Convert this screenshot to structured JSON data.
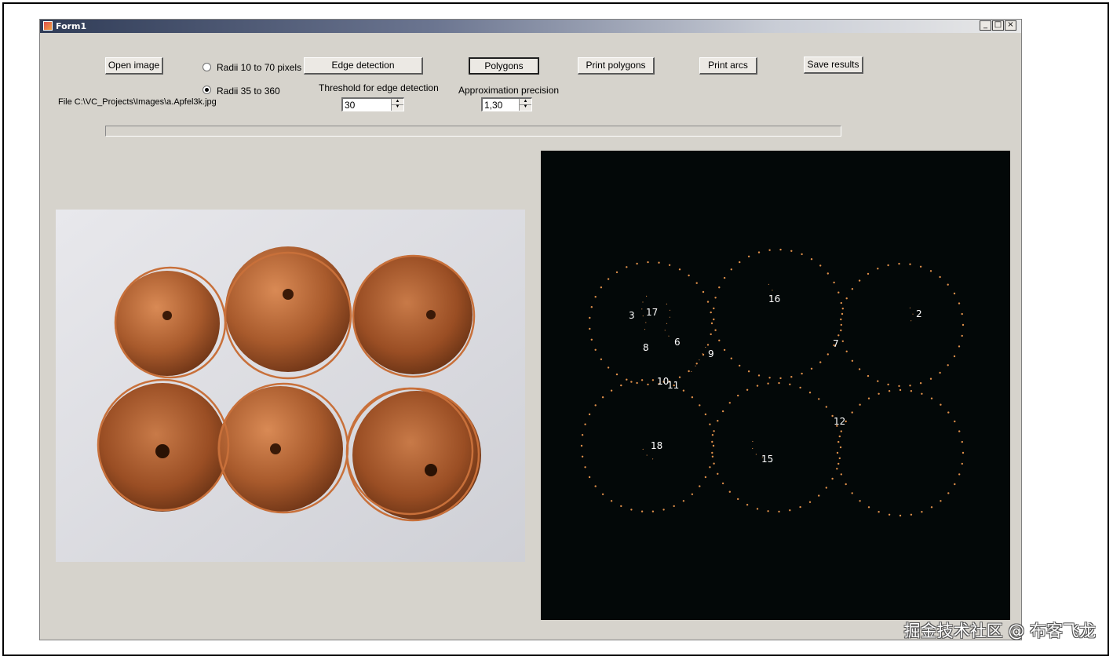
{
  "window": {
    "title": "Form1",
    "minimize_glyph": "_",
    "maximize_glyph": "□",
    "close_glyph": "×"
  },
  "toolbar": {
    "open_image": "Open image",
    "edge_detection": "Edge detection",
    "polygons": "Polygons",
    "print_polygons": "Print polygons",
    "print_arcs": "Print arcs",
    "save_results": "Save results"
  },
  "radii": {
    "option1": "Radii 10 to 70 pixels",
    "option2": "Radii 35  to 360",
    "selected_index": 2
  },
  "file_label": "File C:\\VC_Projects\\Images\\a.Apfel3k.jpg",
  "threshold": {
    "label": "Threshold for edge detection",
    "value": "30"
  },
  "precision": {
    "label": "Approximation precision",
    "value": "1,30"
  },
  "progress": {
    "fraction": 0.0
  },
  "polygon_labels": [
    "3",
    "17",
    "8",
    "6",
    "16",
    "2",
    "7",
    "9",
    "10",
    "11",
    "12",
    "18",
    "15"
  ],
  "colors": {
    "window_bg": "#d6d3cc",
    "polygon_canvas": "#030808",
    "circle_overlay": "#c8703a",
    "polygon_points": "#e0904a"
  },
  "watermark": "掘金技术社区 @ 布客飞龙"
}
